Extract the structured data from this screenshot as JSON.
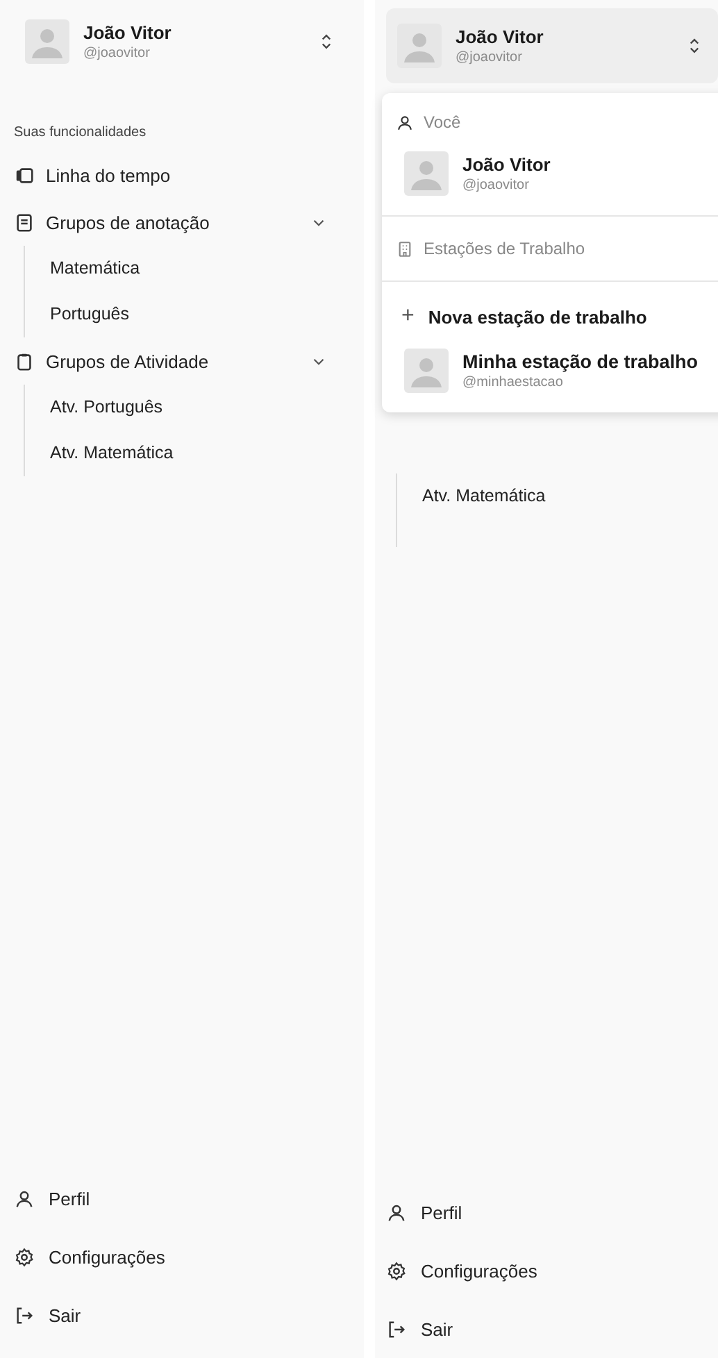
{
  "panels": [
    {
      "switcher": {
        "name": "João Vitor",
        "handle": "@joaovitor",
        "open": false
      },
      "section_title": "Suas funcionalidades",
      "nav": [
        {
          "kind": "item",
          "label": "Linha do tempo"
        },
        {
          "kind": "group",
          "label": "Grupos de anotação",
          "expanded": true,
          "children": [
            {
              "label": "Matemática"
            },
            {
              "label": "Português"
            }
          ]
        },
        {
          "kind": "group",
          "label": "Grupos de Atividade",
          "expanded": true,
          "children": [
            {
              "label": "Atv. Português"
            },
            {
              "label": "Atv. Matemática"
            }
          ]
        }
      ],
      "footer": [
        {
          "label": "Perfil"
        },
        {
          "label": "Configurações"
        },
        {
          "label": "Sair"
        }
      ]
    },
    {
      "switcher": {
        "name": "João Vitor",
        "handle": "@joaovitor",
        "open": true
      },
      "dropdown": {
        "you_label": "Você",
        "user": {
          "name": "João Vitor",
          "handle": "@joaovitor"
        },
        "workspaces_label": "Estações de Trabalho",
        "new_icon": "+",
        "new_label": "Nova estação de trabalho",
        "workspaces": [
          {
            "name": "Minha estação de trabalho",
            "handle": "@minhaestacao"
          }
        ]
      },
      "nav": [
        {
          "kind": "group-tail",
          "children": [
            {
              "label": "Atv. Matemática"
            }
          ]
        }
      ],
      "footer": [
        {
          "label": "Perfil"
        },
        {
          "label": "Configurações"
        },
        {
          "label": "Sair"
        }
      ]
    }
  ]
}
